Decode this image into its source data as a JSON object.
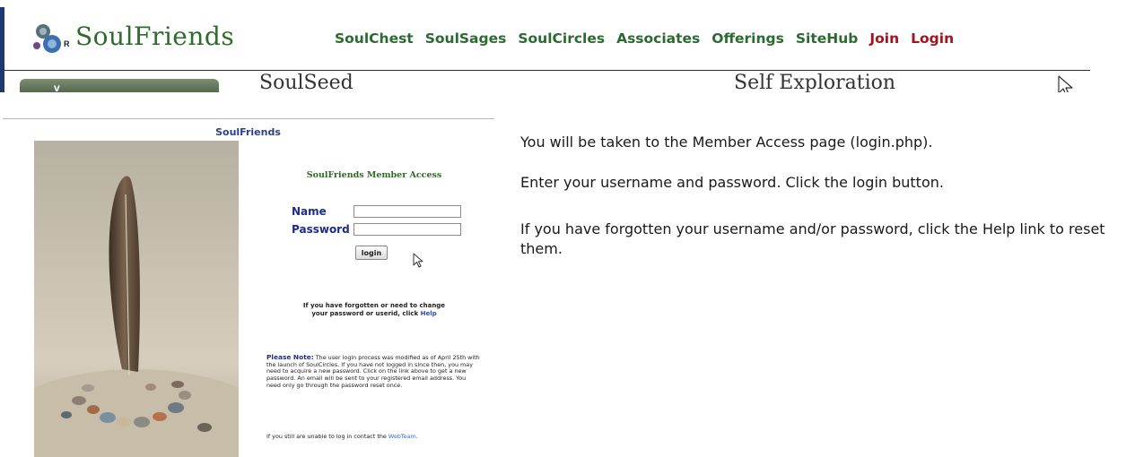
{
  "header": {
    "logo_text": "SoulFriends",
    "logo_mark": "R",
    "nav": [
      {
        "label": "SoulChest",
        "style": "green"
      },
      {
        "label": "SoulSages",
        "style": "green"
      },
      {
        "label": "SoulCircles",
        "style": "green"
      },
      {
        "label": "Associates",
        "style": "green"
      },
      {
        "label": "Offerings",
        "style": "green"
      },
      {
        "label": "SiteHub",
        "style": "green"
      },
      {
        "label": "Join",
        "style": "red"
      },
      {
        "label": "Login",
        "style": "red"
      }
    ],
    "subheadings": [
      "SoulSeed",
      "Self Exploration"
    ],
    "pill_glyph": "v"
  },
  "login_screenshot": {
    "site_title": "SoulFriends",
    "form_heading": "SoulFriends Member Access",
    "name_label": "Name",
    "password_label": "Password",
    "login_button": "login",
    "forgot_line1": "If you have forgotten or need to change",
    "forgot_line2": "your password or userid, click",
    "help_link": "Help",
    "note_label": "Please Note:",
    "note_body": "The user login process was modified as of April 25th with the launch of SoulCircles. If you have not logged in since then, you may need to acquire a new password. Click on the link above to get a new password. An email will be sent to your registered email address. You need only go through the password reset once.",
    "webteam_prefix": "If you still are unable to log in contact the",
    "webteam_link": "WebTeam",
    "webteam_suffix": "."
  },
  "instructions": [
    "You will be taken to the Member Access page (login.php).",
    "Enter your username and password.  Click the login button.",
    "If you have forgotten your username and/or password, click the Help link to reset them."
  ],
  "colors": {
    "nav_green": "#2b6a31",
    "nav_red": "#a3131d",
    "logo_green": "#2d6c2a",
    "label_blue": "#1d2c86",
    "link_blue": "#2c4fb0"
  }
}
